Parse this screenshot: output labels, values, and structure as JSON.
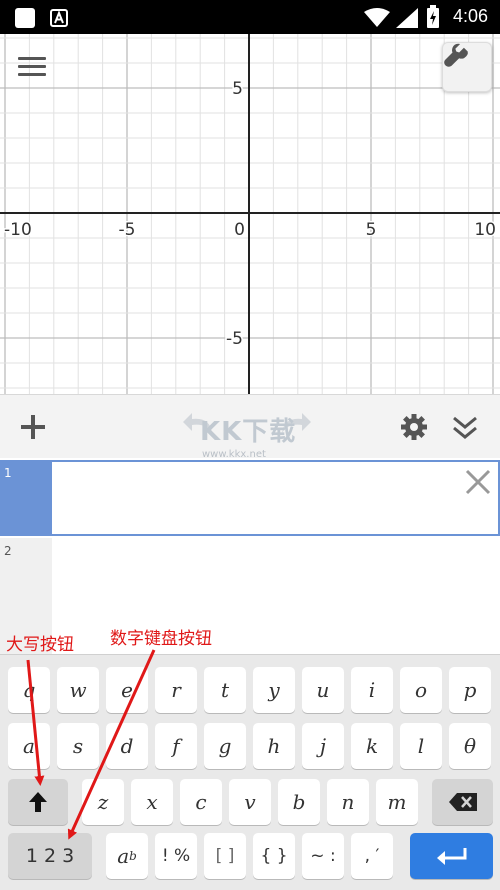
{
  "status_bar": {
    "time": "4:06",
    "icons": [
      "square-icon",
      "a-badge-icon",
      "wifi-icon",
      "signal-icon",
      "battery-charging-icon"
    ]
  },
  "graph": {
    "x_ticks": [
      "-10",
      "-5",
      "0",
      "5",
      "10"
    ],
    "y_ticks": [
      "5",
      "-5"
    ],
    "x_range": [
      -10.5,
      10.5
    ],
    "y_range": [
      -7,
      7
    ],
    "grid": true,
    "menu_icon": "hamburger-icon",
    "settings_icon": "wrench-icon"
  },
  "toolbar": {
    "add_icon": "plus-icon",
    "undo_icon": "undo-icon",
    "redo_icon": "redo-icon",
    "gear_icon": "gear-icon",
    "collapse_icon": "double-chevron-down-icon",
    "watermark_main": "KK下载",
    "watermark_url": "www.kkx.net"
  },
  "expressions": [
    {
      "index": "1",
      "value": ""
    },
    {
      "index": "2",
      "value": ""
    }
  ],
  "keyboard": {
    "row1": [
      "q",
      "w",
      "e",
      "r",
      "t",
      "y",
      "u",
      "i",
      "o",
      "p"
    ],
    "row2": [
      "a",
      "s",
      "d",
      "f",
      "g",
      "h",
      "j",
      "k",
      "l",
      "θ"
    ],
    "row3": [
      "z",
      "x",
      "c",
      "v",
      "b",
      "n",
      "m"
    ],
    "numbers_label": "1 2 3",
    "subscript_base": "a",
    "subscript_sub": "b",
    "punct1": "! %",
    "brackets": "[ ]",
    "braces": "{ }",
    "tilde": "~ :",
    "comma": ", ′"
  },
  "annotations": {
    "caps_label": "大写按钮",
    "numpad_label": "数字键盘按钮",
    "color": "#e01818"
  },
  "colors": {
    "accent": "#6b93d6",
    "enter_key": "#2f7de1"
  }
}
